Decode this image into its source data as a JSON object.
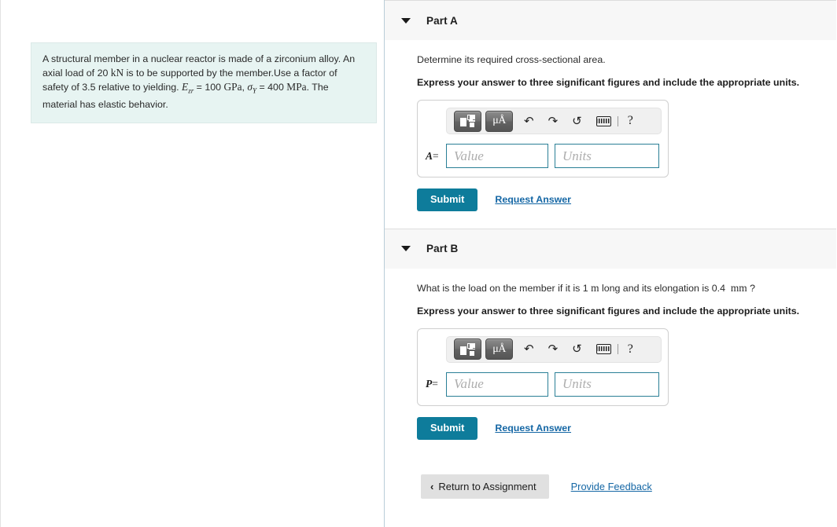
{
  "problem": {
    "text_lines": [
      "A structural member in a nuclear reactor is made of a zirconium alloy. An axial",
      "load of 20  kN is to be supported by the member.Use a factor of safety of 3.5",
      "relative to yielding. E_zr = 100 GPa, σ_Y = 400 MPa. The material has elastic",
      "behavior."
    ],
    "segments": {
      "s1": "A structural member in a nuclear reactor is made of a zirconium alloy. An axial load of 20 ",
      "kn": "kN",
      "s2": " is to be supported by the member.Use a factor of safety of 3.5 relative to yielding. ",
      "e_var": "E",
      "e_sub": "zr",
      "e_eq": " = 100 ",
      "gpa": "GPa",
      "comma": ", ",
      "sigma_var": "σ",
      "sigma_sub": "Y",
      "sigma_eq": " = 400 ",
      "mpa": "MPa",
      "s3": ". The material has elastic behavior."
    }
  },
  "toolbar_icons": {
    "template": "math-template-icon",
    "units": "μÅ",
    "undo": "↶",
    "redo": "↷",
    "reset": "↺",
    "keyboard": "keyboard-icon",
    "help": "?"
  },
  "parts": [
    {
      "id": "a",
      "title": "Part A",
      "question": "Determine its required cross-sectional area.",
      "instruction": "Express your answer to three significant figures and include the appropriate units.",
      "variable": "A",
      "equals": "=",
      "value_placeholder": "Value",
      "units_placeholder": "Units",
      "value": "",
      "units": "",
      "submit_label": "Submit",
      "request_answer_label": "Request Answer"
    },
    {
      "id": "b",
      "title": "Part B",
      "question_segments": {
        "p1": "What is the load on the member if it is 1 ",
        "m": "m",
        "p2": " long and its elongation is 0.4  ",
        "mm": "mm",
        "p3": " ?"
      },
      "question": "What is the load on the member if it is 1 m long and its elongation is 0.4  mm ?",
      "instruction": "Express your answer to three significant figures and include the appropriate units.",
      "variable": "P",
      "equals": "=",
      "value_placeholder": "Value",
      "units_placeholder": "Units",
      "value": "",
      "units": "",
      "submit_label": "Submit",
      "request_answer_label": "Request Answer"
    }
  ],
  "footer": {
    "return_chevron": "‹",
    "return_label": "Return to Assignment",
    "feedback_label": "Provide Feedback"
  },
  "colors": {
    "submit_bg": "#0e7c9b",
    "link": "#1567a5",
    "input_border": "#2a7f96",
    "problem_bg": "#e7f4f2",
    "header_bg": "#f7f7f7",
    "return_bg": "#e0e0e0"
  }
}
